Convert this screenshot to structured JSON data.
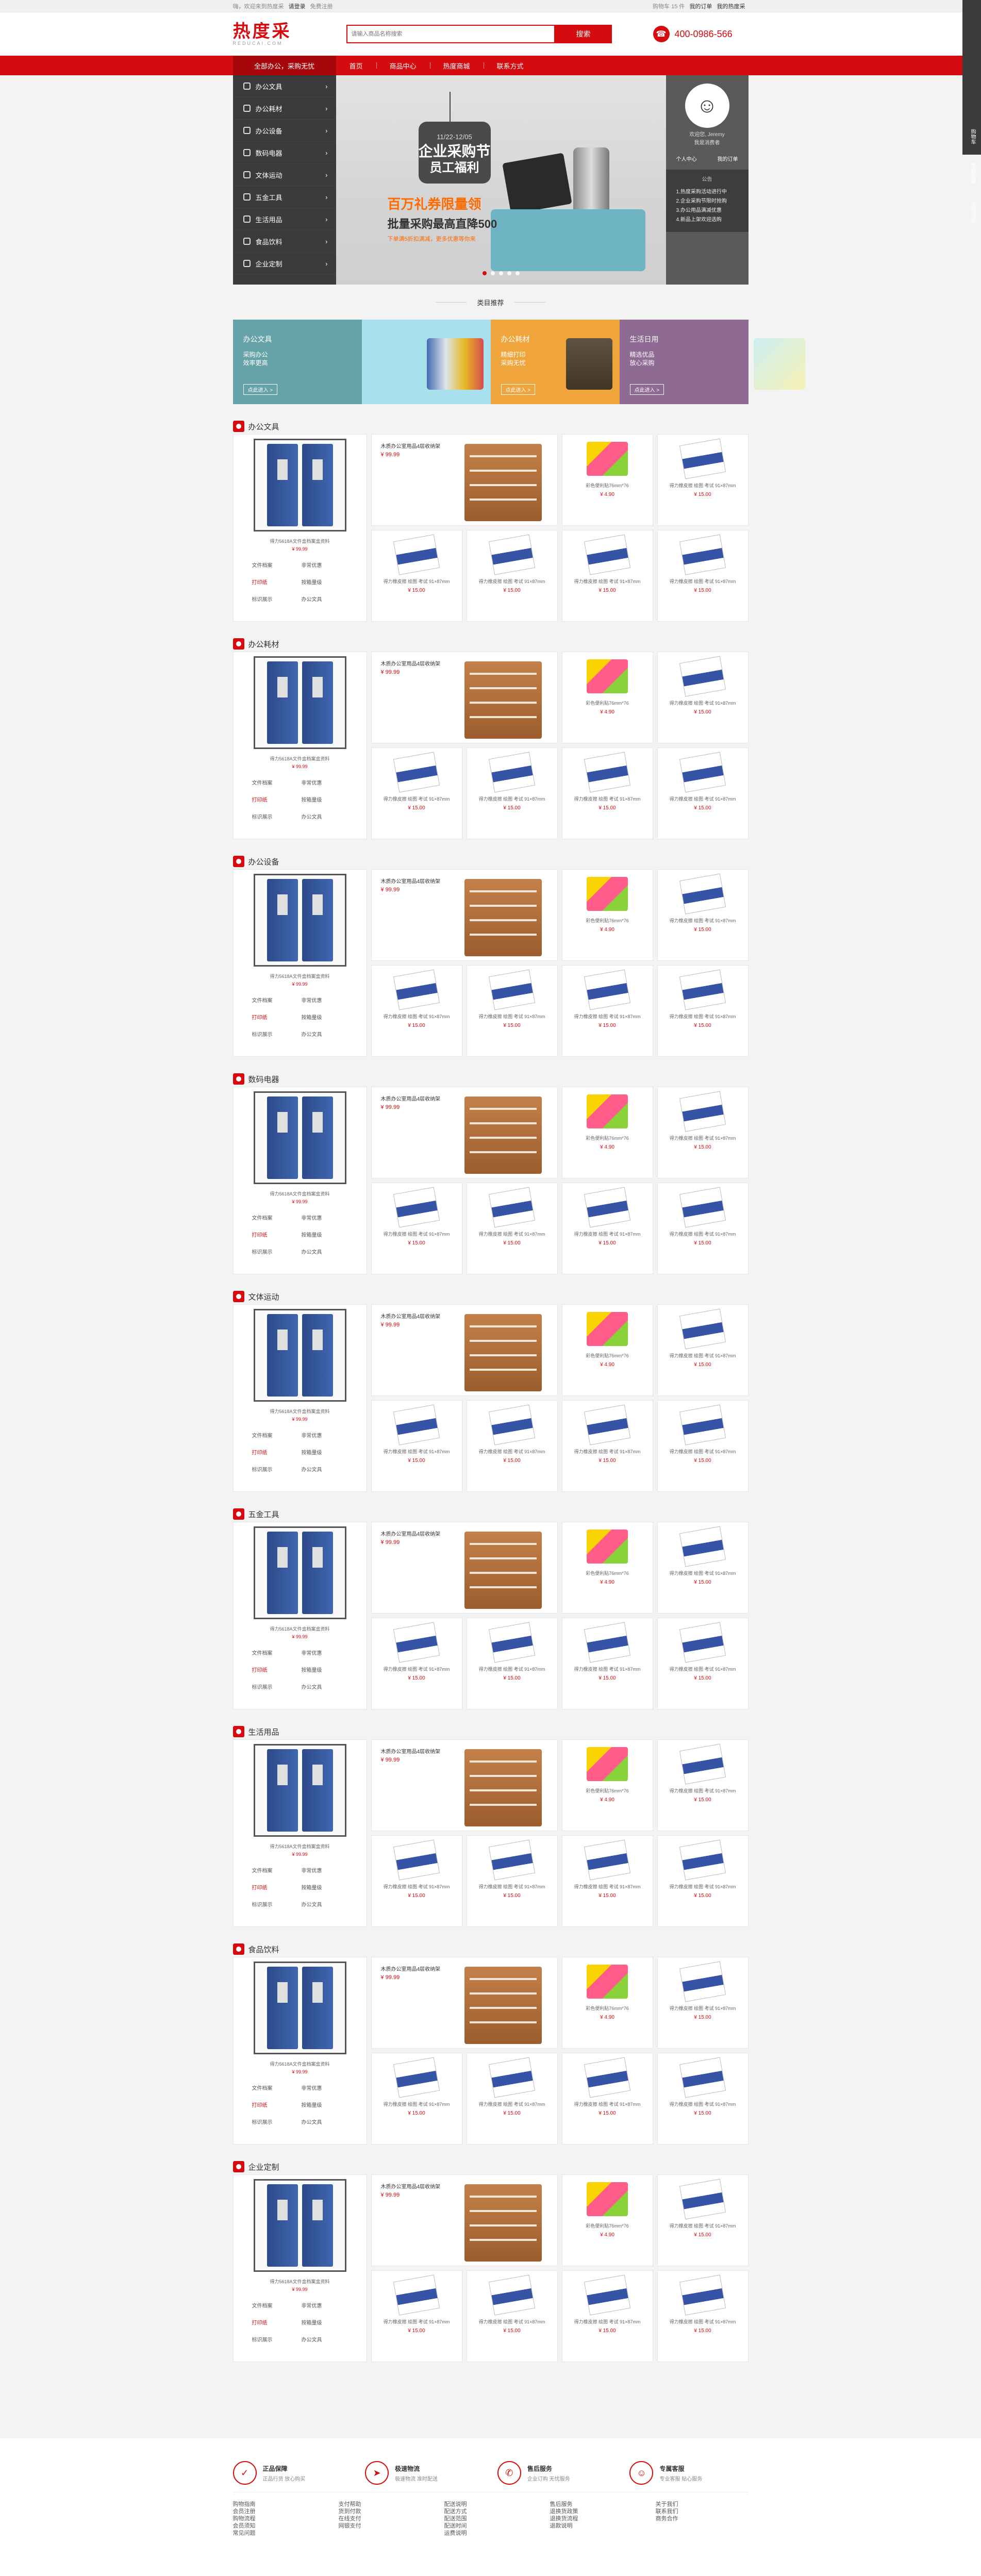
{
  "topbar": {
    "welcome": "嗨，欢迎来到热度采",
    "login": "请登录",
    "register": "免费注册",
    "right": "购物车 15 件",
    "orders": "我的订单",
    "my_account": "我的热度采"
  },
  "header": {
    "logo_cn": "热度采",
    "logo_en": "REDUCAI.COM",
    "search_placeholder": "请输入商品名称搜索",
    "search_button": "搜索",
    "phone": "400-0986-566"
  },
  "nav": {
    "category_title": "全部办公，采购无忧",
    "items": [
      "首页",
      "商品中心",
      "热度商城",
      "联系方式"
    ]
  },
  "categories": [
    "办公文具",
    "办公耗材",
    "办公设备",
    "数码电器",
    "文体运动",
    "五金工具",
    "生活用品",
    "食品饮料",
    "企业定制"
  ],
  "banner": {
    "date": "11/22-12/05",
    "title1": "企业采购节",
    "title2": "员工福利",
    "line1": "百万礼券限量领",
    "line2": "批量采购最高直降500",
    "line3": "下单满5折扣满减，更多优惠等你来"
  },
  "user": {
    "greeting": "欢迎您, Jeremy",
    "status": "我是消费者",
    "link1": "个人中心",
    "link2": "我的订单",
    "box_title": "公告",
    "notices": [
      "1.热度采购活动进行中",
      "2.企业采购节限时抢购",
      "3.办公用品满减优惠",
      "4.新品上架欢迎选购"
    ]
  },
  "recommend": {
    "title": "类目推荐",
    "cards": [
      {
        "title": "办公文具",
        "desc1": "采购办公",
        "desc2": "效率更高",
        "button": "点此进入 >"
      },
      {
        "title": "办公耗材",
        "desc1": "精细打印",
        "desc2": "采购无忧",
        "button": "点此进入 >"
      },
      {
        "title": "生活日用",
        "desc1": "精选优品",
        "desc2": "放心采购",
        "button": "点此进入 >"
      }
    ]
  },
  "floors": [
    {
      "title": "办公文具"
    },
    {
      "title": "办公耗材"
    },
    {
      "title": "办公设备"
    },
    {
      "title": "数码电器"
    },
    {
      "title": "文体运动"
    },
    {
      "title": "五金工具"
    },
    {
      "title": "生活用品"
    },
    {
      "title": "食品饮料"
    },
    {
      "title": "企业定制"
    }
  ],
  "floor_template": {
    "left_name": "得力5618A文件盒档案盒资料",
    "left_price": "¥ 99.99",
    "left_links": [
      "文件档案",
      "非常优惠",
      "打印纸",
      "按箱量级",
      "标识展示",
      "办公文具"
    ],
    "big_name": "木质办公室用品4层收纳架",
    "big_price": "¥ 99.99",
    "sticky_name": "彩色便利贴76mm*76",
    "sticky_price": "¥ 4.90",
    "eraser_name": "得力橡皮擦 绘图 考试 91×87mm",
    "eraser_price": "¥ 15.00"
  },
  "footer": {
    "services": [
      {
        "title": "正品保障",
        "desc": "正品行货 放心购买"
      },
      {
        "title": "极速物流",
        "desc": "极速物流 准时配送"
      },
      {
        "title": "售后服务",
        "desc": "企业订购 无忧服务"
      },
      {
        "title": "专属客服",
        "desc": "专业客服 贴心服务"
      }
    ],
    "columns": [
      [
        "购物指南",
        "会员注册",
        "购物流程",
        "会员须知",
        "常见问题"
      ],
      [
        "支付帮助",
        "货到付款",
        "在线支付",
        "网银支付"
      ],
      [
        "配送说明",
        "配送方式",
        "配送范围",
        "配送时间",
        "运费说明"
      ],
      [
        "售后服务",
        "退换货政策",
        "退换货流程",
        "退款说明"
      ],
      [
        "关于我们",
        "联系我们",
        "商务合作"
      ]
    ]
  },
  "side": [
    "购物车",
    "我的收藏",
    "返回顶部"
  ]
}
